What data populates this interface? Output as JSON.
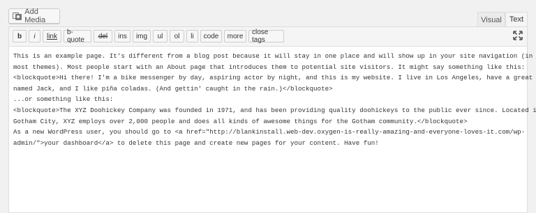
{
  "media": {
    "add_media_label": "Add Media",
    "icon": "media-icon"
  },
  "tabs": [
    {
      "label": "Visual",
      "active": false
    },
    {
      "label": "Text",
      "active": true
    }
  ],
  "toolbar": {
    "buttons": [
      "b",
      "i",
      "link",
      "b-quote",
      "del",
      "ins",
      "img",
      "ul",
      "ol",
      "li",
      "code",
      "more",
      "close tags"
    ],
    "fullscreen_icon": "fullscreen-icon"
  },
  "editor": {
    "lines": [
      "This is an example page. It's different from a blog post because it will stay in one place and will show up in your site navigation (in",
      "most themes). Most people start with an About page that introduces them to potential site visitors. It might say something like this:",
      "<blockquote>Hi there! I'm a bike messenger by day, aspiring actor by night, and this is my website. I live in Los Angeles, have a great dog",
      "named Jack, and I like piña coladas. (And gettin' caught in the rain.)</blockquote>",
      "...or something like this:",
      "<blockquote>The XYZ Doohickey Company was founded in 1971, and has been providing quality doohickeys to the public ever since. Located in",
      "Gotham City, XYZ employs over 2,000 people and does all kinds of awesome things for the Gotham community.</blockquote>",
      "As a new WordPress user, you should go to <a href=\"http://blankinstall.web-dev.oxygen-is-really-amazing-and-everyone-loves-it.com/wp-",
      "admin/\">your dashboard</a> to delete this page and create new pages for your content. Have fun!"
    ]
  },
  "colors": {
    "background": "#f1f1f1",
    "editor_bg": "#ffffff",
    "border": "#dddddd",
    "text": "#333333"
  }
}
